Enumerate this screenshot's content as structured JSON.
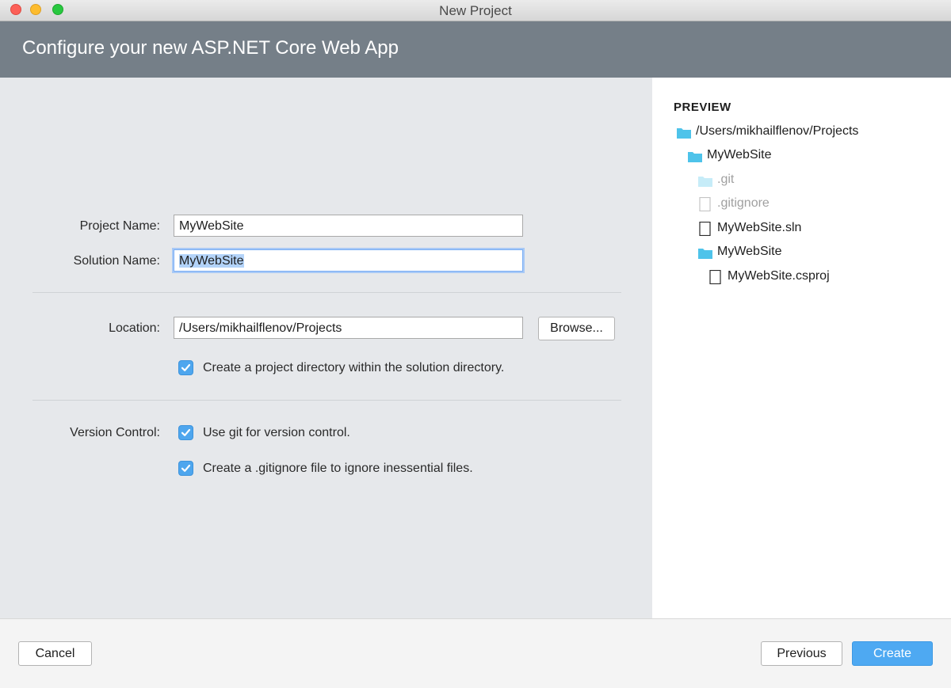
{
  "window": {
    "title": "New Project"
  },
  "header": {
    "title": "Configure your new ASP.NET Core Web App"
  },
  "form": {
    "project_name_label": "Project Name:",
    "project_name_value": "MyWebSite",
    "solution_name_label": "Solution Name:",
    "solution_name_value": "MyWebSite",
    "location_label": "Location:",
    "location_value": "/Users/mikhailflenov/Projects",
    "browse_label": "Browse...",
    "create_dir_label": "Create a project directory within the solution directory.",
    "create_dir_checked": true,
    "version_control_label": "Version Control:",
    "use_git_label": "Use git for version control.",
    "use_git_checked": true,
    "gitignore_label": "Create a .gitignore file to ignore inessential files.",
    "gitignore_checked": true
  },
  "preview": {
    "heading": "PREVIEW",
    "items": [
      {
        "label": "/Users/mikhailflenov/Projects",
        "icon": "folder-icon",
        "dim": false
      },
      {
        "label": "MyWebSite",
        "icon": "folder-icon",
        "dim": false
      },
      {
        "label": ".git",
        "icon": "folder-icon",
        "dim": true
      },
      {
        "label": ".gitignore",
        "icon": "file-icon",
        "dim": true
      },
      {
        "label": "MyWebSite.sln",
        "icon": "file-icon",
        "dim": false
      },
      {
        "label": "MyWebSite",
        "icon": "folder-icon",
        "dim": false
      },
      {
        "label": "MyWebSite.csproj",
        "icon": "file-icon",
        "dim": false
      }
    ]
  },
  "footer": {
    "cancel_label": "Cancel",
    "previous_label": "Previous",
    "create_label": "Create"
  },
  "colors": {
    "accent": "#4ea9f2",
    "banner": "#757f88",
    "folder": "#4ec3ea"
  }
}
